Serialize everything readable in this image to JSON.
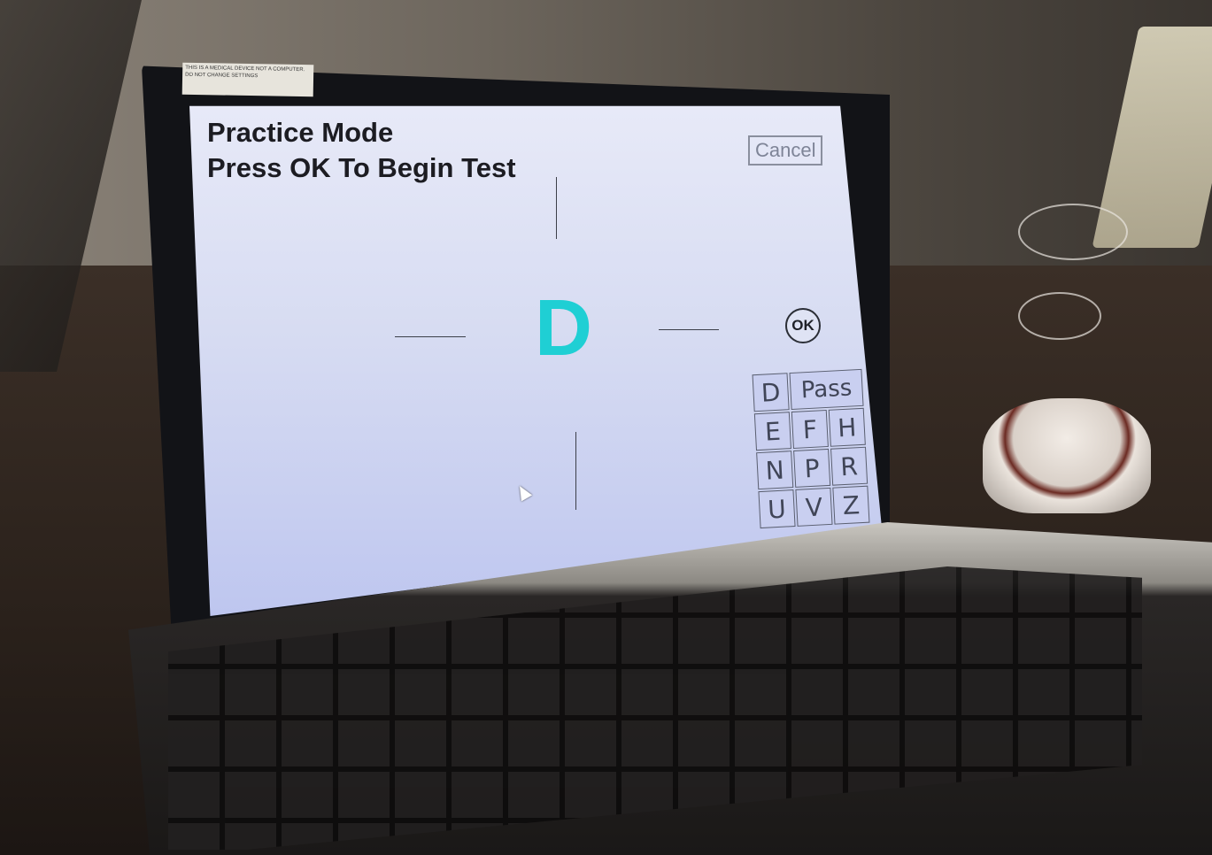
{
  "device": {
    "sticker_text": "THIS IS A MEDICAL DEVICE NOT A COMPUTER. DO NOT CHANGE SETTINGS"
  },
  "screen": {
    "title_line1": "Practice Mode",
    "title_line2": "Press OK To Begin Test",
    "cancel_label": "Cancel",
    "optotype_letter": "D",
    "ok_label": "OK",
    "letter_keys": [
      "D",
      "Pass",
      "E",
      "F",
      "H",
      "N",
      "P",
      "R",
      "U",
      "V",
      "Z"
    ],
    "colors": {
      "optotype": "#1fcfd4",
      "screen_bg": "#d7dcf2"
    }
  }
}
